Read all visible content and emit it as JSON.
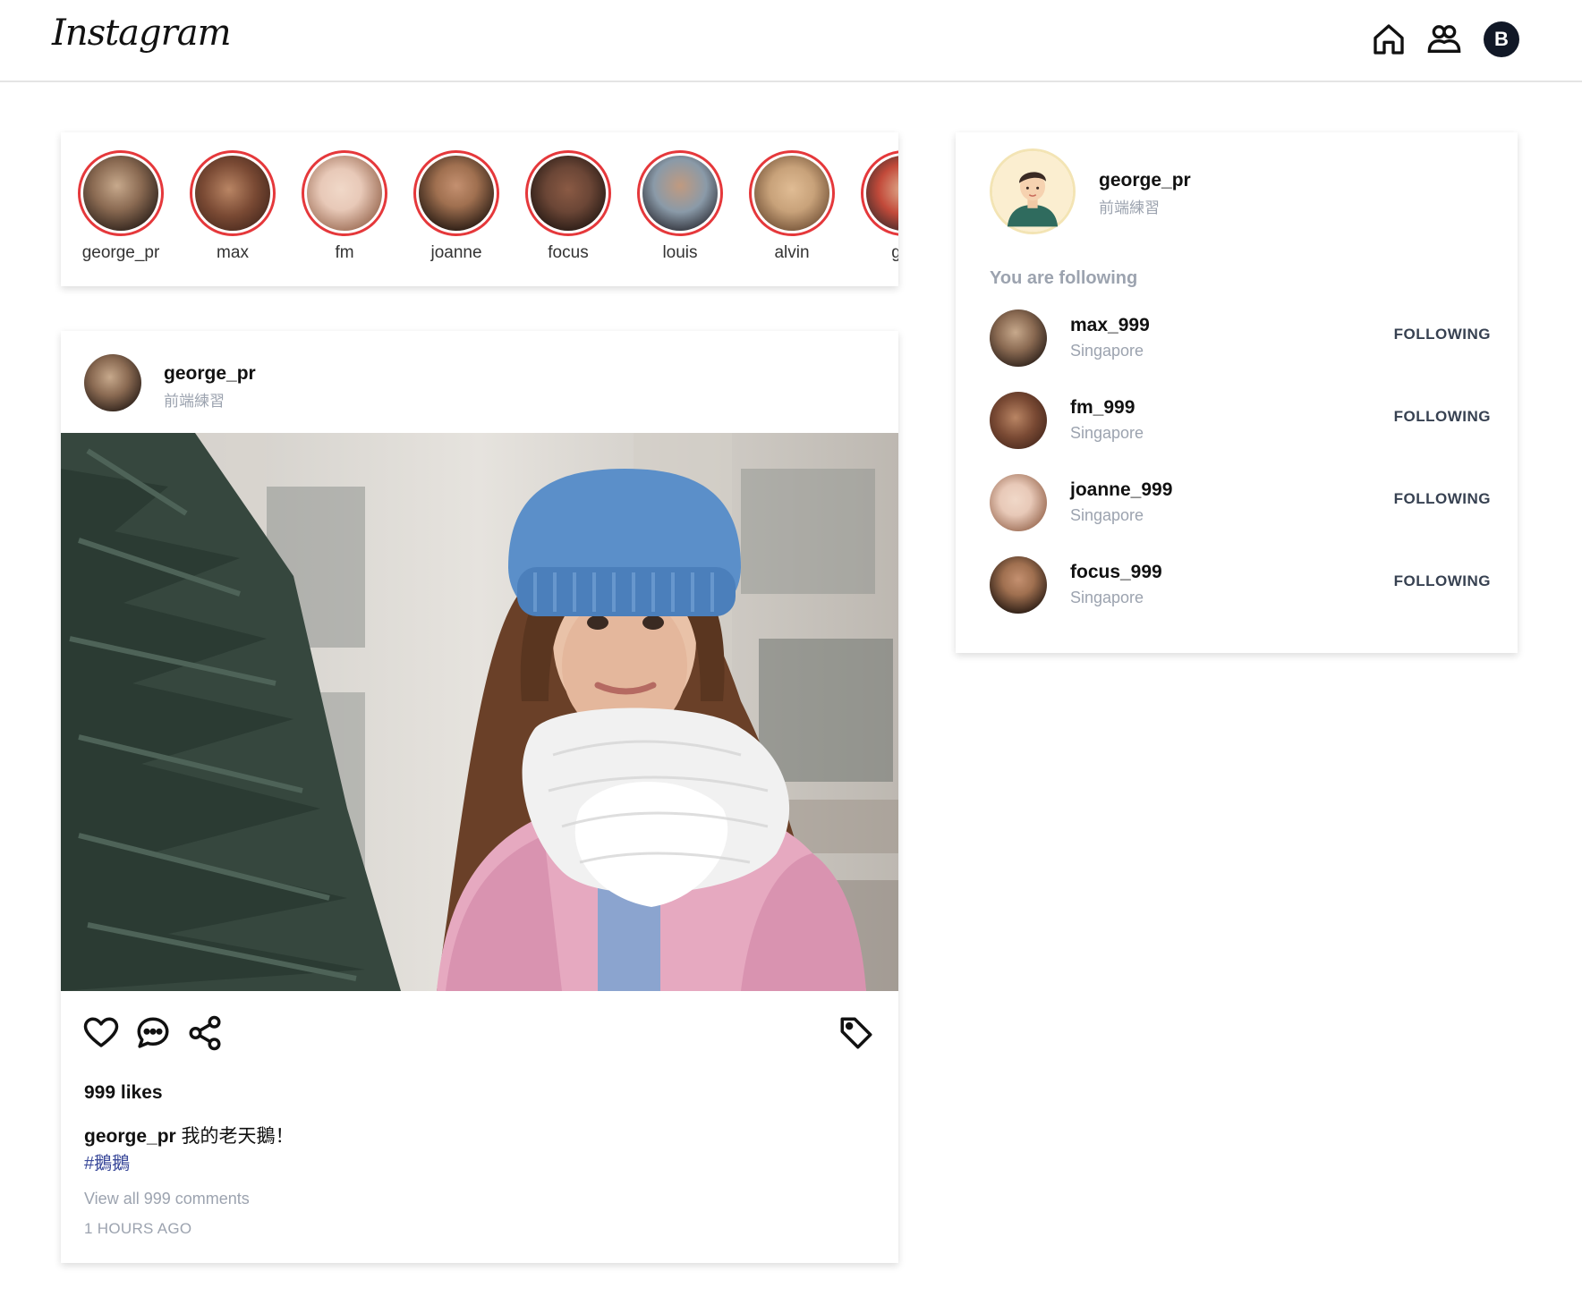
{
  "header": {
    "logo": "Instagram",
    "icons": [
      "home-icon",
      "friends-icon"
    ],
    "profile_initial": "B"
  },
  "stories": [
    {
      "name": "george_pr",
      "colors": [
        "#c7a98c",
        "#3a2b22"
      ]
    },
    {
      "name": "max",
      "colors": [
        "#b98564",
        "#4a2a1e"
      ]
    },
    {
      "name": "fm",
      "colors": [
        "#e8c9b8",
        "#9a6a52"
      ]
    },
    {
      "name": "joanne",
      "colors": [
        "#a07050",
        "#2a1c14"
      ]
    },
    {
      "name": "focus",
      "colors": [
        "#6b4636",
        "#1e1410"
      ]
    },
    {
      "name": "louis",
      "colors": [
        "#8a9aa8",
        "#2a2a32"
      ]
    },
    {
      "name": "alvin",
      "colors": [
        "#c8a27a",
        "#6b4a30"
      ]
    },
    {
      "name": "gra",
      "colors": [
        "#c24a3a",
        "#3a2a2a"
      ]
    }
  ],
  "post": {
    "username": "george_pr",
    "subtitle": "前端練習",
    "likes": "999 likes",
    "caption_user": "george_pr",
    "caption_text": " 我的老天鵝！",
    "hashtag": "#鵝鵝",
    "view_all": "View all 999 comments",
    "time": "1 HOURS AGO",
    "icons": [
      "heart-icon",
      "comment-icon",
      "share-icon",
      "tag-icon"
    ]
  },
  "sidebar": {
    "me": {
      "name": "george_pr",
      "subtitle": "前端練習"
    },
    "following_title": "You are following",
    "following": [
      {
        "name": "max_999",
        "location": "Singapore",
        "button": "FOLLOWING"
      },
      {
        "name": "fm_999",
        "location": "Singapore",
        "button": "FOLLOWING"
      },
      {
        "name": "joanne_999",
        "location": "Singapore",
        "button": "FOLLOWING"
      },
      {
        "name": "focus_999",
        "location": "Singapore",
        "button": "FOLLOWING"
      }
    ]
  },
  "colors": {
    "story_ring": "#e5383b",
    "muted": "#9ca3af",
    "hashtag": "#3b4a9a",
    "profile_badge": "#111827"
  }
}
